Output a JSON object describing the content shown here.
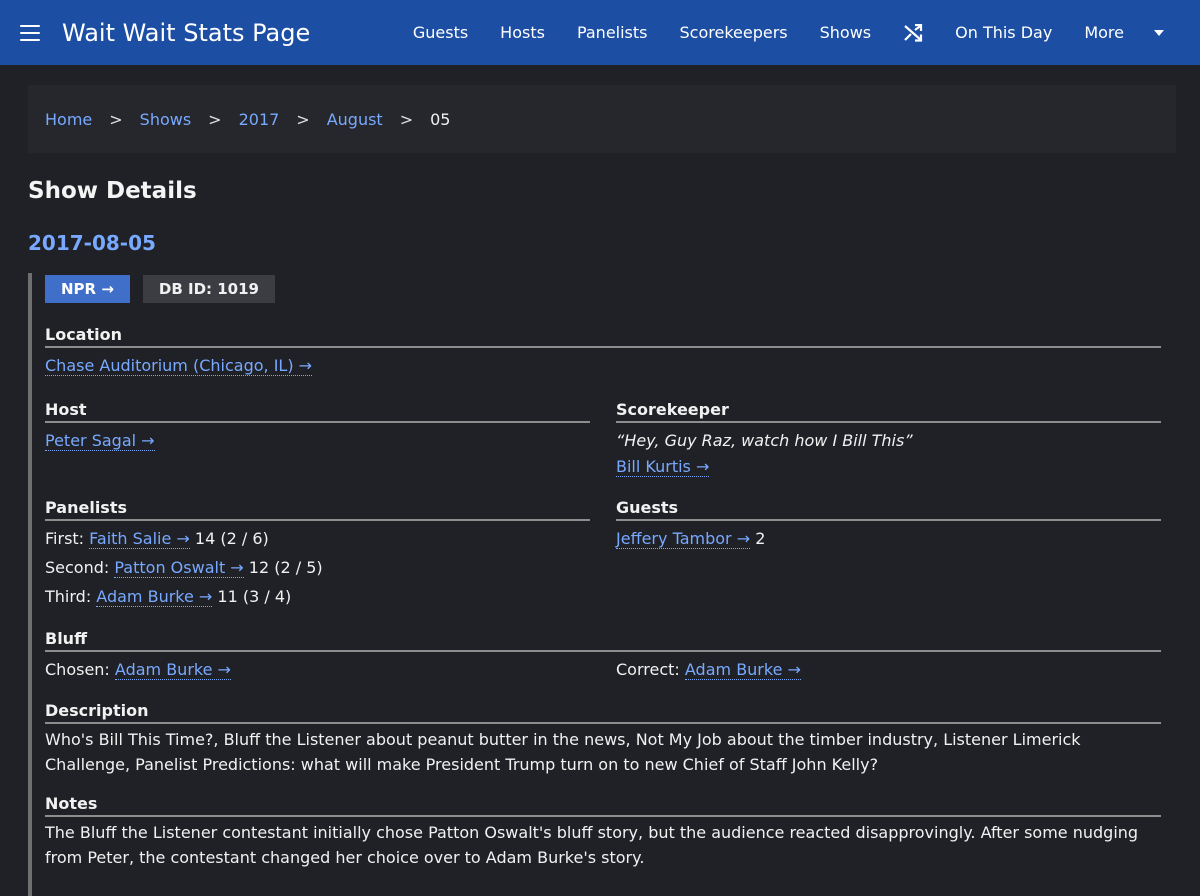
{
  "site": {
    "title": "Wait Wait Stats Page"
  },
  "nav": {
    "items": [
      "Guests",
      "Hosts",
      "Panelists",
      "Scorekeepers",
      "Shows"
    ],
    "random_icon": "shuffle-icon",
    "on_this_day": "On This Day",
    "more": "More"
  },
  "breadcrumb": {
    "home": "Home",
    "shows": "Shows",
    "year": "2017",
    "month": "August",
    "day": "05",
    "sep": ">"
  },
  "page": {
    "title": "Show Details",
    "date": "2017-08-05"
  },
  "badges": {
    "npr": "NPR →",
    "db_id": "DB ID: 1019"
  },
  "location": {
    "label": "Location",
    "value": "Chase Auditorium (Chicago, IL) →"
  },
  "host": {
    "label": "Host",
    "name": "Peter Sagal →"
  },
  "scorekeeper": {
    "label": "Scorekeeper",
    "quote": "“Hey, Guy Raz, watch how I Bill This”",
    "name": "Bill Kurtis →"
  },
  "panelists": {
    "label": "Panelists",
    "items": [
      {
        "position": "First:",
        "name": "Faith Salie →",
        "score": "14 (2 / 6)"
      },
      {
        "position": "Second:",
        "name": "Patton Oswalt →",
        "score": "12 (2 / 5)"
      },
      {
        "position": "Third:",
        "name": "Adam Burke →",
        "score": "11 (3 / 4)"
      }
    ]
  },
  "guests": {
    "label": "Guests",
    "items": [
      {
        "name": "Jeffery Tambor →",
        "score": "2"
      }
    ]
  },
  "bluff": {
    "label": "Bluff",
    "chosen_label": "Chosen:",
    "chosen": "Adam Burke →",
    "correct_label": "Correct:",
    "correct": "Adam Burke →"
  },
  "description": {
    "label": "Description",
    "text": "Who's Bill This Time?, Bluff the Listener about peanut butter in the news, Not My Job about the timber industry, Listener Limerick Challenge, Panelist Predictions: what will make President Trump turn on to new Chief of Staff John Kelly?"
  },
  "notes": {
    "label": "Notes",
    "text": "The Bluff the Listener contestant initially chose Patton Oswalt's bluff story, but the audience reacted disapprovingly. After some nudging from Peter, the contestant changed her choice over to Adam Burke's story."
  }
}
